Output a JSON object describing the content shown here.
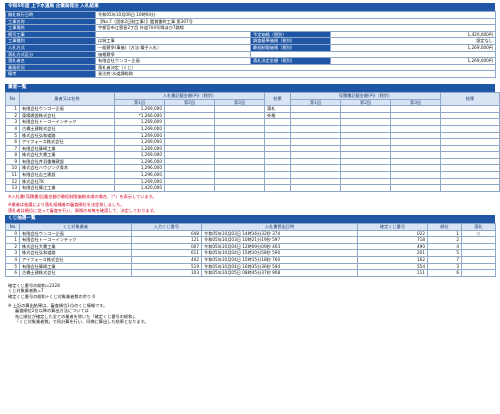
{
  "title": "令和5年度 上下水道局 企業局発注 入札結果",
  "info": {
    "rows": [
      {
        "label": "開札執行日時",
        "value": "令和05年10月06日 10時04分"
      },
      {
        "label": "工事名称",
        "value": "【No.7（過休2日制工事）】鑑賞番町工事 第307号"
      },
      {
        "label": "工事場所",
        "value": "宇都宮市江曽島2丁目 外道704号線ほか7路線"
      }
    ],
    "pairs": [
      {
        "l1": "競写工事",
        "v1": "",
        "l2": "予定価格（税別）",
        "v2": "1,420,000円"
      },
      {
        "l1": "工事種別",
        "v1": "は装工事",
        "l2": "調査基準価格（税別）",
        "v2": "設定なし"
      },
      {
        "l1": "入札方式",
        "v1": "一般競争(事後)（方法:電子入札）",
        "l2": "最低制限価格（税別）",
        "v2": "1,269,000円"
      },
      {
        "l1": "落札方式区分",
        "v1": "価格競争",
        "l2": "",
        "v2": ""
      },
      {
        "l1": "落札者名",
        "v1": "有限会社ウンコー企画",
        "l2": "落札決定金額（税別）",
        "v2": "1,269,000円"
      }
    ],
    "tail": [
      {
        "label": "業務状況",
        "value": "落札者決定（くじ）"
      },
      {
        "label": "備考",
        "value": "発注終:水道課総務"
      }
    ]
  },
  "bid_table": {
    "section": "業者一覧",
    "headers": {
      "no": "No",
      "name": "業者又は名称",
      "bid_group": "入札書記載金額(円)（税別）",
      "bid_rounds": [
        "第1回",
        "第2回",
        "第3回"
      ],
      "result": "結果",
      "hope_group": "見積書記載金額(円)（税別）",
      "hope_rounds": [
        "第1回",
        "第2回",
        "第3回"
      ],
      "hope_result": "結果"
    },
    "rows": [
      {
        "no": "1",
        "name": "有限会社ウンコー企画",
        "amount": "1,269,000",
        "result": "落札"
      },
      {
        "no": "2",
        "name": "東陽建設株式会社",
        "amount": "*1,266,000",
        "result": "失格"
      },
      {
        "no": "3",
        "name": "有限会社トーコーインテック",
        "amount": "1,269,000",
        "result": ""
      },
      {
        "no": "4",
        "name": "古橋土建株式会社",
        "amount": "1,269,000",
        "result": ""
      },
      {
        "no": "5",
        "name": "株式会社弘和道路",
        "amount": "1,269,000",
        "result": ""
      },
      {
        "no": "6",
        "name": "アイフォース株式会社",
        "amount": "1,269,000",
        "result": ""
      },
      {
        "no": "7",
        "name": "有限会社篠崎工業",
        "amount": "1,269,000",
        "result": ""
      },
      {
        "no": "8",
        "name": "株式会社大貫工業",
        "amount": "1,269,000",
        "result": ""
      },
      {
        "no": "9",
        "name": "有限会社井羽重機建設",
        "amount": "1,296,000",
        "result": ""
      },
      {
        "no": "10",
        "name": "株式会社ハウジング青木",
        "amount": "1,296,000",
        "result": ""
      },
      {
        "no": "11",
        "name": "有限会社吉三建設",
        "amount": "1,296,000",
        "result": ""
      },
      {
        "no": "12",
        "name": "株式会社TK",
        "amount": "1,269,000",
        "result": ""
      },
      {
        "no": "13",
        "name": "有限会社篠江工業",
        "amount": "1,420,000",
        "result": ""
      }
    ]
  },
  "notes": {
    "red1": "※入札書(見積書)記載金額が最低制限価格未満の場合、『*』を表示しています。",
    "red2a": "※業者は抽選により落札候補者の審査順位を決定致しました。",
    "red2b": "落札者は順位に従って審査を行い、資格の有無を確認して、決定しております。"
  },
  "lottery": {
    "section": "くじ抽選一覧",
    "headers": {
      "no": "No",
      "name": "くじ対象業者",
      "input": "入力くじ番号",
      "date": "入札書提出日時",
      "confirm": "確定くじ番号",
      "rank": "順位",
      "won": "落札"
    },
    "rows": [
      {
        "no": "0",
        "name": "有限会社ウンコー企画",
        "input": "648",
        "date": "令和05年10月03日 14時16分32秒 374",
        "confirm": "022",
        "rank": "1",
        "won": "○"
      },
      {
        "no": "1",
        "name": "有限会社トーコーインテック",
        "input": "121",
        "date": "令和05年10月03日 10時21分19秒 597",
        "confirm": "718",
        "rank": "2",
        "won": ""
      },
      {
        "no": "2",
        "name": "株式会社大貫工業",
        "input": "007",
        "date": "令和05年10月04日 12時09分09秒 403",
        "confirm": "490",
        "rank": "4",
        "won": ""
      },
      {
        "no": "3",
        "name": "株式会社弘和道路",
        "input": "611",
        "date": "令和05年10月04日 15時10分58秒 590",
        "confirm": "201",
        "rank": "5",
        "won": ""
      },
      {
        "no": "4",
        "name": "アイフォース株式会社",
        "input": "402",
        "date": "令和05年10月04日 15時15分18秒 760",
        "confirm": "162",
        "rank": "7",
        "won": ""
      },
      {
        "no": "5",
        "name": "有限会社篠崎工業",
        "input": "519",
        "date": "令和05年10月04日 16時35分36秒 594",
        "confirm": "554",
        "rank": "3",
        "won": ""
      },
      {
        "no": "6",
        "name": "古橋土建株式会社",
        "input": "103",
        "date": "令和05年10月05日 08時45分37秒 908",
        "confirm": "111",
        "rank": "6",
        "won": ""
      }
    ]
  },
  "footer": {
    "l1": "確定くじ番号の総和=2328",
    "l2": "くじ対象業者数=7",
    "l3": "確定くじ番号の総和÷くじ対象業者数の余り:0",
    "l4": "※ 上記の算出結果は、審査順位1位のくじ情報です。",
    "l5": "審査順位2位以降の算出方法については",
    "l6": "先に順位が確定した全ての業者を除いた「確定くじ番号の総和」、",
    "l7": "「くじ対象業者数」で再計算を行い、同様に算出した結果となります。"
  }
}
